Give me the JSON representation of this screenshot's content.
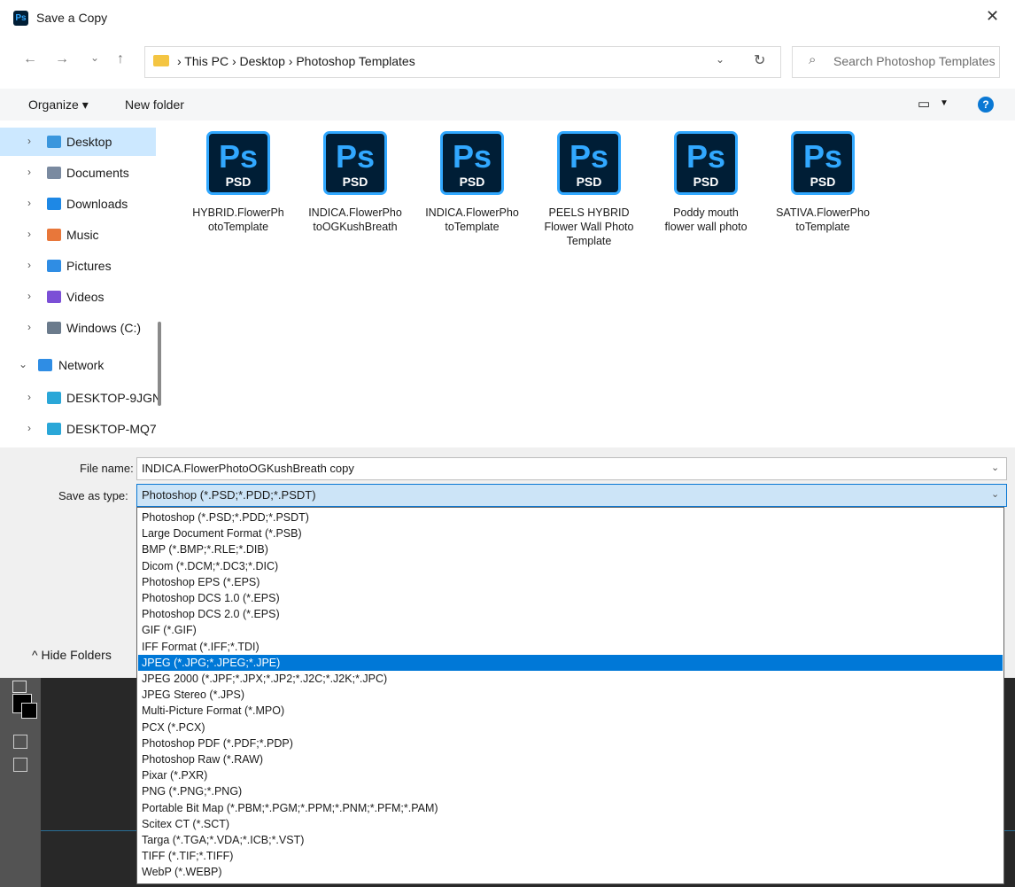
{
  "window": {
    "title": "Save a Copy",
    "app_badge": "Ps",
    "close_glyph": "✕"
  },
  "nav_buttons": {
    "back": "←",
    "forward": "→",
    "recent": "⌄",
    "up": "↑"
  },
  "address": {
    "breadcrumb": "›  This PC  ›  Desktop  ›  Photoshop Templates",
    "chevron": "⌄",
    "refresh": "↻"
  },
  "search": {
    "placeholder": "Search Photoshop Templates",
    "icon": "⌕"
  },
  "toolbar": {
    "organize": "Organize ▾",
    "new_folder": "New folder",
    "view_icon": "▭",
    "view_caret": "▼",
    "help": "?"
  },
  "sidebar": {
    "items": [
      {
        "label": "Desktop",
        "chev": "›",
        "icon": "desktop-folder-icon",
        "color": "#3a96dd"
      },
      {
        "label": "Documents",
        "chev": "›",
        "icon": "documents-icon",
        "color": "#7a8aa0"
      },
      {
        "label": "Downloads",
        "chev": "›",
        "icon": "downloads-icon",
        "color": "#1e88e5"
      },
      {
        "label": "Music",
        "chev": "›",
        "icon": "music-icon",
        "color": "#e8773a"
      },
      {
        "label": "Pictures",
        "chev": "›",
        "icon": "pictures-icon",
        "color": "#2f8de4"
      },
      {
        "label": "Videos",
        "chev": "›",
        "icon": "videos-icon",
        "color": "#7b4fd6"
      },
      {
        "label": "Windows (C:)",
        "chev": "›",
        "icon": "drive-icon",
        "color": "#6b7b8c"
      },
      {
        "label": "Network",
        "chev": "⌄",
        "icon": "network-icon",
        "color": "#2f8de4"
      },
      {
        "label": "DESKTOP-9JGN",
        "chev": "›",
        "icon": "computer-icon",
        "color": "#2aa7d8"
      },
      {
        "label": "DESKTOP-MQ7",
        "chev": "›",
        "icon": "computer-icon",
        "color": "#2aa7d8"
      }
    ]
  },
  "files": [
    {
      "name": "HYBRID.FlowerPhotoTemplate",
      "badge": "Ps",
      "ext": "PSD"
    },
    {
      "name": "INDICA.FlowerPhotoOGKushBreath",
      "badge": "Ps",
      "ext": "PSD"
    },
    {
      "name": "INDICA.FlowerPhotoTemplate",
      "badge": "Ps",
      "ext": "PSD"
    },
    {
      "name": "PEELS HYBRID Flower Wall Photo Template",
      "badge": "Ps",
      "ext": "PSD"
    },
    {
      "name": "Poddy mouth flower wall photo",
      "badge": "Ps",
      "ext": "PSD"
    },
    {
      "name": "SATIVA.FlowerPhotoTemplate",
      "badge": "Ps",
      "ext": "PSD"
    }
  ],
  "form": {
    "file_name_label": "File name:",
    "file_name_value": "INDICA.FlowerPhotoOGKushBreath copy",
    "save_type_label": "Save as type:",
    "save_type_value": "Photoshop (*.PSD;*.PDD;*.PSDT)",
    "chevron": "⌄",
    "hide_folders": "^  Hide Folders"
  },
  "type_options": [
    "Photoshop (*.PSD;*.PDD;*.PSDT)",
    "Large Document Format (*.PSB)",
    "BMP (*.BMP;*.RLE;*.DIB)",
    "Dicom (*.DCM;*.DC3;*.DIC)",
    "Photoshop EPS (*.EPS)",
    "Photoshop DCS 1.0 (*.EPS)",
    "Photoshop DCS 2.0 (*.EPS)",
    "GIF (*.GIF)",
    "IFF Format (*.IFF;*.TDI)",
    "JPEG (*.JPG;*.JPEG;*.JPE)",
    "JPEG 2000 (*.JPF;*.JPX;*.JP2;*.J2C;*.J2K;*.JPC)",
    "JPEG Stereo (*.JPS)",
    "Multi-Picture Format (*.MPO)",
    "PCX (*.PCX)",
    "Photoshop PDF (*.PDF;*.PDP)",
    "Photoshop Raw (*.RAW)",
    "Pixar (*.PXR)",
    "PNG (*.PNG;*.PNG)",
    "Portable Bit Map (*.PBM;*.PGM;*.PPM;*.PNM;*.PFM;*.PAM)",
    "Scitex CT (*.SCT)",
    "Targa (*.TGA;*.VDA;*.ICB;*.VST)",
    "TIFF (*.TIF;*.TIFF)",
    "WebP (*.WEBP)"
  ],
  "selected_type": "JPEG (*.JPG;*.JPEG;*.JPE)"
}
